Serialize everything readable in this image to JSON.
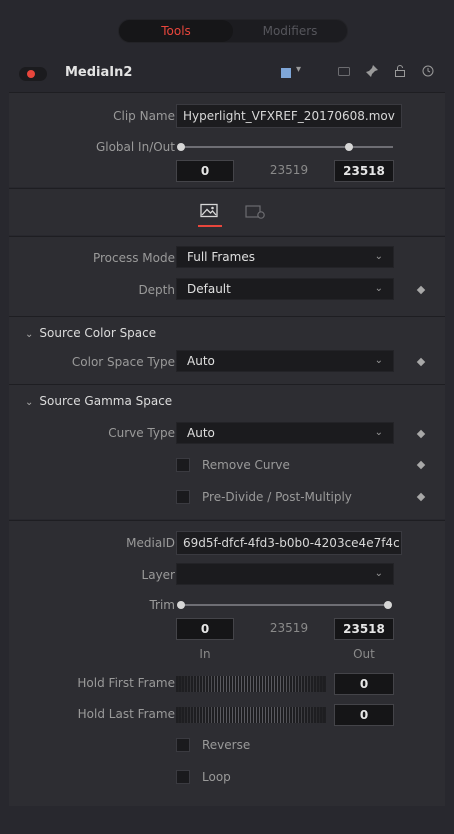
{
  "tabs": {
    "tools": "Tools",
    "modifiers": "Modifiers"
  },
  "node": {
    "name": "MediaIn2",
    "chip_color": "#7fa6d8"
  },
  "clip": {
    "clip_name_label": "Clip Name",
    "clip_name_value": "Hyperlight_VFXREF_20170608.mov",
    "global_label": "Global In/Out",
    "global_in": "0",
    "global_mid": "23519",
    "global_out": "23518"
  },
  "inspector_tabs": {
    "image_tab": "image-icon",
    "settings_tab": "settings-icon"
  },
  "image": {
    "process_mode_label": "Process Mode",
    "process_mode_value": "Full Frames",
    "depth_label": "Depth",
    "depth_value": "Default",
    "source_color_space_heading": "Source Color Space",
    "color_space_type_label": "Color Space Type",
    "color_space_type_value": "Auto",
    "source_gamma_heading": "Source Gamma Space",
    "curve_type_label": "Curve Type",
    "curve_type_value": "Auto",
    "remove_curve_label": "Remove Curve",
    "predivide_label": "Pre-Divide / Post-Multiply"
  },
  "media": {
    "media_id_label": "MediaID",
    "media_id_value": "69d5f-dfcf-4fd3-b0b0-4203ce4e7f4c",
    "layer_label": "Layer",
    "layer_value": "",
    "trim_label": "Trim",
    "trim_in": "0",
    "trim_mid": "23519",
    "trim_out": "23518",
    "in_caption": "In",
    "out_caption": "Out",
    "hold_first_label": "Hold First Frame",
    "hold_first_value": "0",
    "hold_last_label": "Hold Last Frame",
    "hold_last_value": "0",
    "reverse_label": "Reverse",
    "loop_label": "Loop"
  },
  "colors": {
    "accent": "#e8463c",
    "background": "#28282e",
    "panel": "#2d2d32"
  }
}
